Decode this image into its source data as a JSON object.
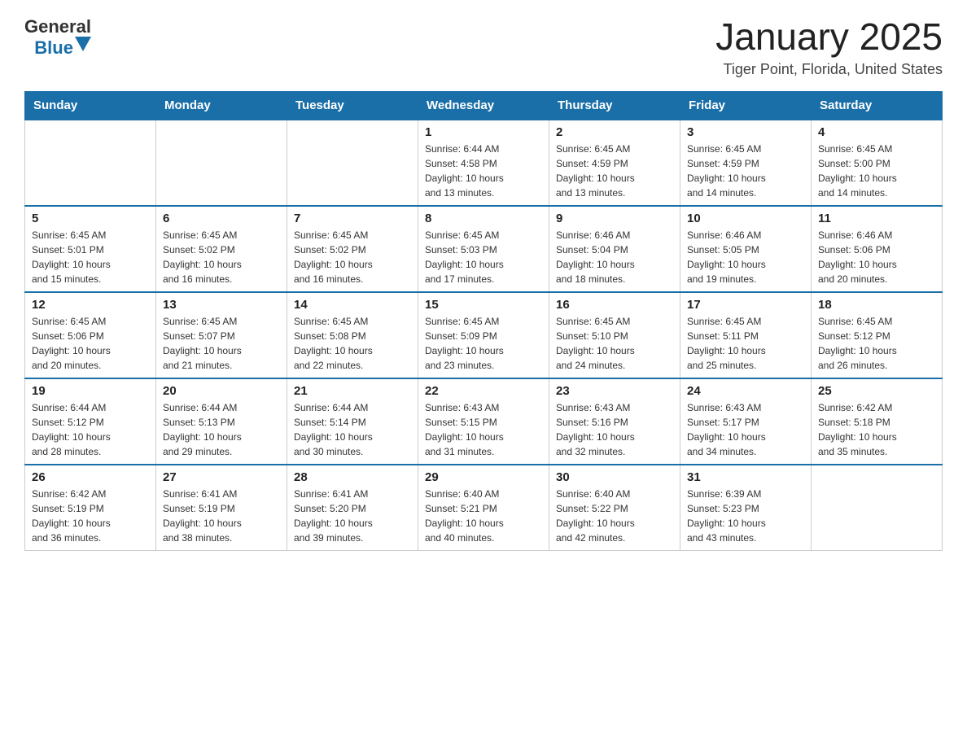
{
  "header": {
    "logo": {
      "general": "General",
      "blue": "Blue"
    },
    "title": "January 2025",
    "subtitle": "Tiger Point, Florida, United States"
  },
  "calendar": {
    "weekdays": [
      "Sunday",
      "Monday",
      "Tuesday",
      "Wednesday",
      "Thursday",
      "Friday",
      "Saturday"
    ],
    "weeks": [
      [
        {
          "day": "",
          "info": ""
        },
        {
          "day": "",
          "info": ""
        },
        {
          "day": "",
          "info": ""
        },
        {
          "day": "1",
          "info": "Sunrise: 6:44 AM\nSunset: 4:58 PM\nDaylight: 10 hours\nand 13 minutes."
        },
        {
          "day": "2",
          "info": "Sunrise: 6:45 AM\nSunset: 4:59 PM\nDaylight: 10 hours\nand 13 minutes."
        },
        {
          "day": "3",
          "info": "Sunrise: 6:45 AM\nSunset: 4:59 PM\nDaylight: 10 hours\nand 14 minutes."
        },
        {
          "day": "4",
          "info": "Sunrise: 6:45 AM\nSunset: 5:00 PM\nDaylight: 10 hours\nand 14 minutes."
        }
      ],
      [
        {
          "day": "5",
          "info": "Sunrise: 6:45 AM\nSunset: 5:01 PM\nDaylight: 10 hours\nand 15 minutes."
        },
        {
          "day": "6",
          "info": "Sunrise: 6:45 AM\nSunset: 5:02 PM\nDaylight: 10 hours\nand 16 minutes."
        },
        {
          "day": "7",
          "info": "Sunrise: 6:45 AM\nSunset: 5:02 PM\nDaylight: 10 hours\nand 16 minutes."
        },
        {
          "day": "8",
          "info": "Sunrise: 6:45 AM\nSunset: 5:03 PM\nDaylight: 10 hours\nand 17 minutes."
        },
        {
          "day": "9",
          "info": "Sunrise: 6:46 AM\nSunset: 5:04 PM\nDaylight: 10 hours\nand 18 minutes."
        },
        {
          "day": "10",
          "info": "Sunrise: 6:46 AM\nSunset: 5:05 PM\nDaylight: 10 hours\nand 19 minutes."
        },
        {
          "day": "11",
          "info": "Sunrise: 6:46 AM\nSunset: 5:06 PM\nDaylight: 10 hours\nand 20 minutes."
        }
      ],
      [
        {
          "day": "12",
          "info": "Sunrise: 6:45 AM\nSunset: 5:06 PM\nDaylight: 10 hours\nand 20 minutes."
        },
        {
          "day": "13",
          "info": "Sunrise: 6:45 AM\nSunset: 5:07 PM\nDaylight: 10 hours\nand 21 minutes."
        },
        {
          "day": "14",
          "info": "Sunrise: 6:45 AM\nSunset: 5:08 PM\nDaylight: 10 hours\nand 22 minutes."
        },
        {
          "day": "15",
          "info": "Sunrise: 6:45 AM\nSunset: 5:09 PM\nDaylight: 10 hours\nand 23 minutes."
        },
        {
          "day": "16",
          "info": "Sunrise: 6:45 AM\nSunset: 5:10 PM\nDaylight: 10 hours\nand 24 minutes."
        },
        {
          "day": "17",
          "info": "Sunrise: 6:45 AM\nSunset: 5:11 PM\nDaylight: 10 hours\nand 25 minutes."
        },
        {
          "day": "18",
          "info": "Sunrise: 6:45 AM\nSunset: 5:12 PM\nDaylight: 10 hours\nand 26 minutes."
        }
      ],
      [
        {
          "day": "19",
          "info": "Sunrise: 6:44 AM\nSunset: 5:12 PM\nDaylight: 10 hours\nand 28 minutes."
        },
        {
          "day": "20",
          "info": "Sunrise: 6:44 AM\nSunset: 5:13 PM\nDaylight: 10 hours\nand 29 minutes."
        },
        {
          "day": "21",
          "info": "Sunrise: 6:44 AM\nSunset: 5:14 PM\nDaylight: 10 hours\nand 30 minutes."
        },
        {
          "day": "22",
          "info": "Sunrise: 6:43 AM\nSunset: 5:15 PM\nDaylight: 10 hours\nand 31 minutes."
        },
        {
          "day": "23",
          "info": "Sunrise: 6:43 AM\nSunset: 5:16 PM\nDaylight: 10 hours\nand 32 minutes."
        },
        {
          "day": "24",
          "info": "Sunrise: 6:43 AM\nSunset: 5:17 PM\nDaylight: 10 hours\nand 34 minutes."
        },
        {
          "day": "25",
          "info": "Sunrise: 6:42 AM\nSunset: 5:18 PM\nDaylight: 10 hours\nand 35 minutes."
        }
      ],
      [
        {
          "day": "26",
          "info": "Sunrise: 6:42 AM\nSunset: 5:19 PM\nDaylight: 10 hours\nand 36 minutes."
        },
        {
          "day": "27",
          "info": "Sunrise: 6:41 AM\nSunset: 5:19 PM\nDaylight: 10 hours\nand 38 minutes."
        },
        {
          "day": "28",
          "info": "Sunrise: 6:41 AM\nSunset: 5:20 PM\nDaylight: 10 hours\nand 39 minutes."
        },
        {
          "day": "29",
          "info": "Sunrise: 6:40 AM\nSunset: 5:21 PM\nDaylight: 10 hours\nand 40 minutes."
        },
        {
          "day": "30",
          "info": "Sunrise: 6:40 AM\nSunset: 5:22 PM\nDaylight: 10 hours\nand 42 minutes."
        },
        {
          "day": "31",
          "info": "Sunrise: 6:39 AM\nSunset: 5:23 PM\nDaylight: 10 hours\nand 43 minutes."
        },
        {
          "day": "",
          "info": ""
        }
      ]
    ]
  }
}
